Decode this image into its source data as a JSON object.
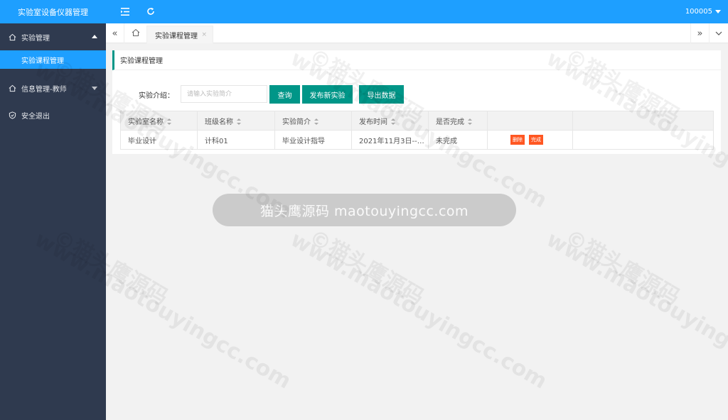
{
  "sidebar": {
    "brand": "实验室设备仪器管理",
    "groups": [
      {
        "label": "实验管理",
        "expanded": true,
        "items": [
          {
            "label": "实验课程管理",
            "active": true
          }
        ]
      },
      {
        "label": "信息管理-教师",
        "expanded": false
      },
      {
        "label": "安全退出"
      }
    ]
  },
  "topbar": {
    "menu_icon": "menu-fold-icon",
    "refresh_icon": "refresh-icon",
    "user": "100005"
  },
  "tabs": {
    "home_icon": "home-icon",
    "active": {
      "label": "实验课程管理",
      "close": "×"
    },
    "nav_left": "«",
    "nav_right": "»"
  },
  "panel": {
    "title": "实验课程管理",
    "search": {
      "label": "实验介绍：",
      "placeholder": "请输入实验简介",
      "value": ""
    },
    "buttons": {
      "query": "查询",
      "publish": "发布新实验",
      "export": "导出数据"
    },
    "table": {
      "columns": [
        "实验室名称",
        "班级名称",
        "实验简介",
        "发布时间",
        "是否完成",
        ""
      ],
      "rows": [
        {
          "lab": "毕业设计",
          "class": "计科01",
          "intro": "毕业设计指导",
          "time": "2021年11月3日--1...",
          "done": "未完成",
          "actions": {
            "delete": "删除",
            "complete": "完成"
          }
        }
      ]
    }
  },
  "overlay": {
    "text": "猫头鹰源码 maotouyingcc.com"
  },
  "watermark": {
    "brand": "©猫头鹰源码",
    "site": "www.maotouyingcc.com"
  },
  "colors": {
    "primary": "#1e9fff",
    "sidebar": "#2f3a4f",
    "button": "#009688",
    "danger": "#ff5722"
  }
}
